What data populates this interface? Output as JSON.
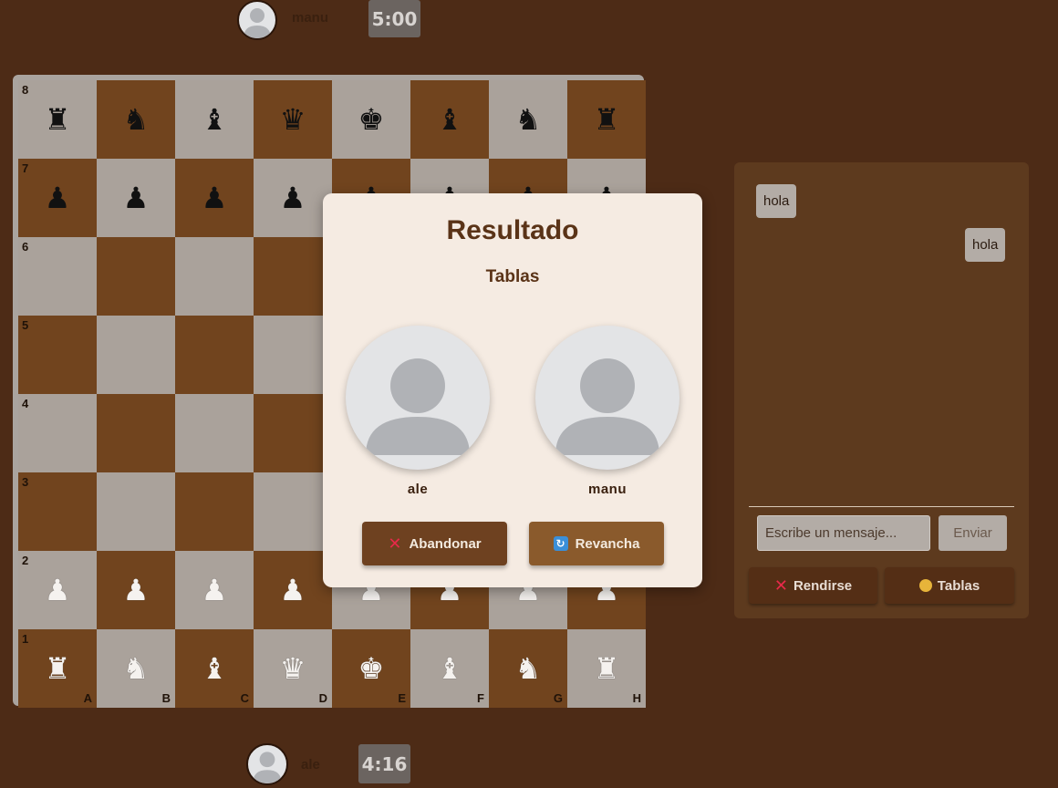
{
  "top_player": {
    "name": "manu",
    "timer": "5:00"
  },
  "bottom_player": {
    "name": "ale",
    "timer": "4:16"
  },
  "board": {
    "ranks": [
      "8",
      "7",
      "6",
      "5",
      "4",
      "3",
      "2",
      "1"
    ],
    "files": [
      "A",
      "B",
      "C",
      "D",
      "E",
      "F",
      "G",
      "H"
    ],
    "pieces": [
      [
        "♜",
        "♞",
        "♝",
        "♛",
        "♚",
        "♝",
        "♞",
        "♜"
      ],
      [
        "♟",
        "♟",
        "♟",
        "♟",
        "♟",
        "♟",
        "♟",
        "♟"
      ],
      [
        "",
        "",
        "",
        "",
        "",
        "",
        "",
        ""
      ],
      [
        "",
        "",
        "",
        "",
        "",
        "",
        "",
        ""
      ],
      [
        "",
        "",
        "",
        "",
        "",
        "",
        "",
        ""
      ],
      [
        "",
        "",
        "",
        "",
        "",
        "",
        "",
        ""
      ],
      [
        "♟",
        "♟",
        "♟",
        "♟",
        "♟",
        "♟",
        "♟",
        "♟"
      ],
      [
        "♜",
        "♞",
        "♝",
        "♛",
        "♚",
        "♝",
        "♞",
        "♜"
      ]
    ],
    "piece_colors": [
      "black",
      "black",
      "",
      "",
      "",
      "",
      "white",
      "white"
    ]
  },
  "chat": {
    "messages": [
      {
        "text": "hola",
        "side": "left"
      },
      {
        "text": "hola",
        "side": "right"
      }
    ],
    "input_placeholder": "Escribe un mensaje...",
    "send_label": "Enviar",
    "resign_label": "Rendirse",
    "draw_label": "Tablas"
  },
  "modal": {
    "title": "Resultado",
    "subtitle": "Tablas",
    "player_left": "ale",
    "player_right": "manu",
    "abandon_label": "Abandonar",
    "rematch_label": "Revancha"
  },
  "colors": {
    "background": "#4d2b16",
    "light_square": "#aaa29b",
    "dark_square": "#71441e",
    "modal_bg": "#f5ebe2",
    "abandon_btn": "#6e4120",
    "rematch_btn": "#8a5a2c"
  },
  "icons": {
    "avatar": "user-silhouette-icon",
    "resign": "cross-icon",
    "draw": "handshake-icon",
    "rematch": "refresh-icon"
  }
}
